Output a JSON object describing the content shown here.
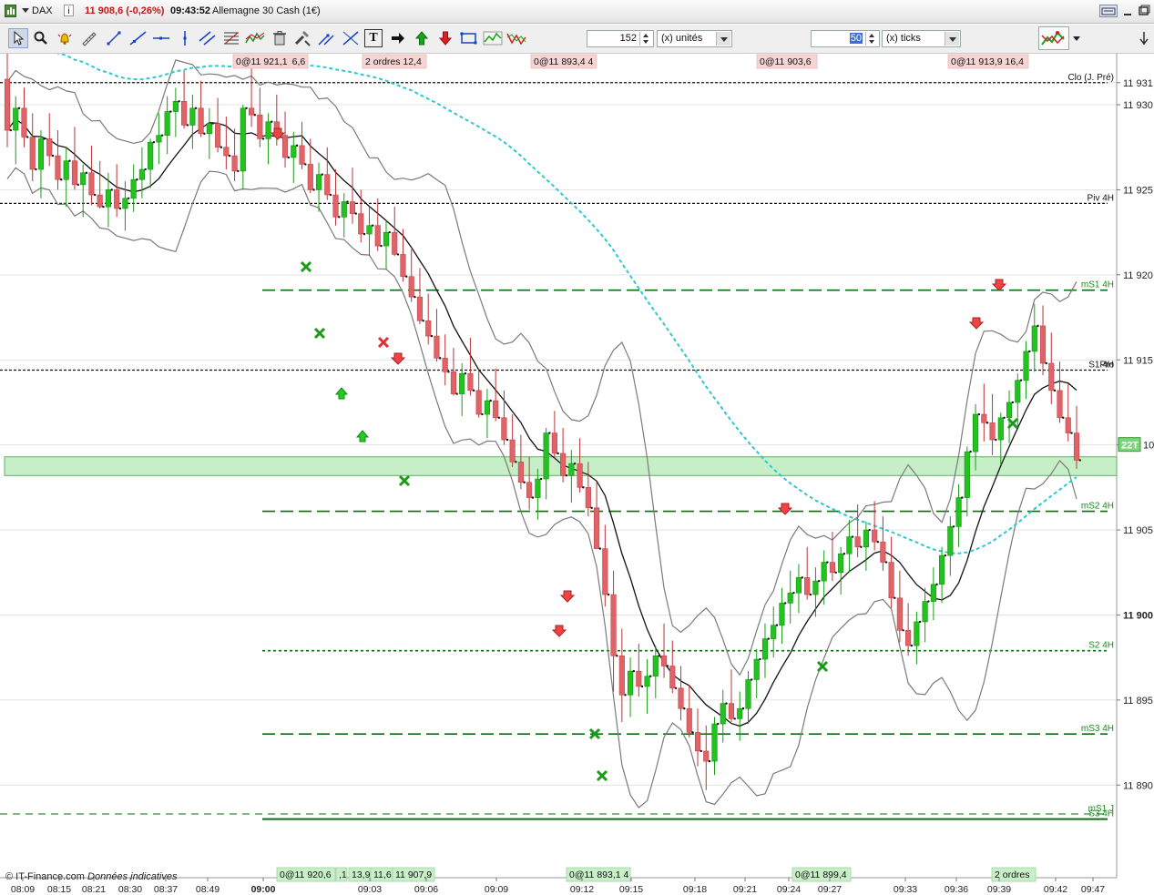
{
  "window": {
    "symbol": "DAX",
    "info": "i",
    "price_change": "11 908,6 (-0,26%)",
    "time": "09:43:52",
    "instrument": "Allemagne 30 Cash (1€)"
  },
  "toolbar": {
    "quantity_value": "152",
    "quantity_unit": "(x) unités",
    "ticks_value": "50",
    "ticks_unit": "(x) ticks"
  },
  "credit": {
    "source": "© IT-Finance.com",
    "note": "Données indicatives"
  },
  "colors": {
    "up": "#22c21f",
    "down": "#e06368",
    "bollinger": "#7a7a7a",
    "mid": "#111111",
    "ma_slow": "#2ec8cf",
    "level_dark": "#0b6e12",
    "zone": "#c7efc7",
    "label_red": "#f7d4d4",
    "label_green": "#c8f0c8"
  },
  "chart_data": {
    "type": "candlestick",
    "instrument": "Allemagne 30 Cash (1€)",
    "ylim": [
      11886,
      11933
    ],
    "ytick_labels": [
      "11 931,",
      "11 930",
      "11 925",
      "11 920",
      "11 915",
      "22T",
      "11 905",
      "11 900",
      "11 895",
      "11 890"
    ],
    "ytick_values": [
      11931.3,
      11930,
      11925,
      11920,
      11915,
      11910,
      11905,
      11900,
      11895,
      11890
    ],
    "xtick_labels": [
      "08:09",
      "08:15",
      "08:21",
      "08:30",
      "08:37",
      "08:49",
      "09:00",
      "09:03",
      "09:06",
      "09:09",
      "09:12",
      "09:15",
      "09:18",
      "09:21",
      "09:24",
      "09:27",
      "09:33",
      "09:36",
      "09:39",
      "09:42",
      "09:47"
    ],
    "current_price": 11908.6,
    "levels": [
      {
        "label": "Clo (J. Pré)",
        "value": 11931.3,
        "style": "dotted-black"
      },
      {
        "label": "Piv 4H",
        "value": 11924.2,
        "style": "dotted-black"
      },
      {
        "label": "mS1 4H",
        "value": 11919.1,
        "style": "dashed-green"
      },
      {
        "label": "S1 4H",
        "value": 11914.4,
        "style": "dotted-black"
      },
      {
        "label": "Pro",
        "value": 11914.4,
        "style": "dotted-black"
      },
      {
        "label": "mS2 4H",
        "value": 11906.1,
        "style": "dashed-green"
      },
      {
        "label": "S2 4H",
        "value": 11897.9,
        "style": "dotted-green"
      },
      {
        "label": "mS3 4H",
        "value": 11893.0,
        "style": "dashed-green"
      },
      {
        "label": "mS1 J",
        "value": 11888.3,
        "style": "dashed-green"
      },
      {
        "label": "S3 4H",
        "value": 11888.0,
        "style": "solid-green"
      }
    ],
    "zone": {
      "from": 11908.2,
      "to": 11909.3
    },
    "order_labels_top": [
      "0@11 921,1  6,6",
      "2 ordres 12,4",
      "0@11 893,4 4",
      "0@11 903,6",
      "0@11 913,9 16,4"
    ],
    "order_labels_bottom": [
      "0@11 920,6",
      ",1",
      "13,9",
      "11,6",
      "11 907,9",
      "0@11 893,1 4",
      "0@11 899,4",
      "2 ordres"
    ],
    "ohlc": [
      [
        11931.5,
        11933,
        11927.5,
        11928.5
      ],
      [
        11928.5,
        11930.5,
        11926.5,
        11929.8
      ],
      [
        11929.8,
        11931,
        11927.5,
        11928.1
      ],
      [
        11928.1,
        11929.5,
        11925.5,
        11926.2
      ],
      [
        11926.2,
        11928.5,
        11924.5,
        11928
      ],
      [
        11928,
        11929.5,
        11926.4,
        11927
      ],
      [
        11927,
        11928.5,
        11925,
        11925.6
      ],
      [
        11925.6,
        11927.5,
        11924,
        11926.7
      ],
      [
        11926.7,
        11928.7,
        11925,
        11925.3
      ],
      [
        11925.3,
        11926.5,
        11923.4,
        11926
      ],
      [
        11926,
        11927.6,
        11924.1,
        11924.7
      ],
      [
        11924.7,
        11926.7,
        11923.9,
        11924
      ],
      [
        11924,
        11926,
        11922.8,
        11925
      ],
      [
        11925,
        11926.5,
        11923.4,
        11923.9
      ],
      [
        11923.9,
        11925.5,
        11922.6,
        11924.5
      ],
      [
        11924.5,
        11926.5,
        11923.7,
        11925.6
      ],
      [
        11925.6,
        11927.5,
        11924.5,
        11926.2
      ],
      [
        11926.2,
        11928,
        11925.1,
        11927.8
      ],
      [
        11927.8,
        11929.5,
        11926.5,
        11928.2
      ],
      [
        11928.2,
        11930.5,
        11927.1,
        11929.6
      ],
      [
        11929.6,
        11931,
        11928.1,
        11930.2
      ],
      [
        11930.2,
        11932,
        11928.6,
        11928.8
      ],
      [
        11928.8,
        11930.6,
        11927.4,
        11929.8
      ],
      [
        11929.8,
        11931.4,
        11928.1,
        11928.3
      ],
      [
        11928.3,
        11929.8,
        11926.8,
        11928.9
      ],
      [
        11928.9,
        11930.4,
        11927.2,
        11927.5
      ],
      [
        11927.5,
        11929.3,
        11926.2,
        11927
      ],
      [
        11927,
        11928.6,
        11925.5,
        11926.1
      ],
      [
        11926.1,
        11930,
        11925,
        11929.8
      ],
      [
        11929.8,
        11932.5,
        11928.7,
        11929.4
      ],
      [
        11929.4,
        11931,
        11927.5,
        11928
      ],
      [
        11928,
        11929.5,
        11926.5,
        11929
      ],
      [
        11929,
        11930.6,
        11927.6,
        11928.2
      ],
      [
        11928.2,
        11929.6,
        11926.3,
        11926.9
      ],
      [
        11926.9,
        11928.4,
        11925.4,
        11927.6
      ],
      [
        11927.6,
        11929,
        11926.2,
        11926.5
      ],
      [
        11926.5,
        11928,
        11924.8,
        11925
      ],
      [
        11925,
        11926.6,
        11923.7,
        11925.9
      ],
      [
        11925.9,
        11927.5,
        11924.4,
        11924.7
      ],
      [
        11924.7,
        11926.2,
        11922.9,
        11923.4
      ],
      [
        11923.4,
        11924.8,
        11922.2,
        11924.3
      ],
      [
        11924.3,
        11926.3,
        11923,
        11923.6
      ],
      [
        11923.6,
        11925,
        11921.9,
        11922.4
      ],
      [
        11922.4,
        11924,
        11921.1,
        11922.9
      ],
      [
        11922.9,
        11924.5,
        11921.4,
        11921.7
      ],
      [
        11921.7,
        11923.2,
        11920.3,
        11922.5
      ],
      [
        11922.5,
        11924,
        11921.1,
        11921.2
      ],
      [
        11921.2,
        11922.7,
        11919.6,
        11919.9
      ],
      [
        11919.9,
        11921.5,
        11918.4,
        11918.7
      ],
      [
        11918.7,
        11920.4,
        11917.1,
        11917.3
      ],
      [
        11917.3,
        11918.9,
        11915.9,
        11916.4
      ],
      [
        11916.4,
        11918,
        11914.9,
        11915.1
      ],
      [
        11915.1,
        11916.5,
        11913.5,
        11914.3
      ],
      [
        11914.3,
        11915.7,
        11912.9,
        11913
      ],
      [
        11913,
        11914.8,
        11911.7,
        11914.2
      ],
      [
        11914.2,
        11916.3,
        11912.9,
        11913.2
      ],
      [
        11913.2,
        11914.5,
        11911.6,
        11911.8
      ],
      [
        11911.8,
        11913.3,
        11910.4,
        11912.6
      ],
      [
        11912.6,
        11914.5,
        11911.4,
        11911.6
      ],
      [
        11911.6,
        11913.2,
        11910,
        11910.3
      ],
      [
        11910.3,
        11911.8,
        11908.7,
        11909
      ],
      [
        11909,
        11910.6,
        11907.4,
        11907.8
      ],
      [
        11907.8,
        11909.3,
        11906.2,
        11906.9
      ],
      [
        11906.9,
        11908.6,
        11905.6,
        11908
      ],
      [
        11908,
        11911,
        11906.8,
        11910.7
      ],
      [
        11910.7,
        11912,
        11909.2,
        11909.5
      ],
      [
        11909.5,
        11911,
        11907.8,
        11908.2
      ],
      [
        11908.2,
        11909.7,
        11906.6,
        11908.9
      ],
      [
        11908.9,
        11910.4,
        11907.2,
        11907.5
      ],
      [
        11907.5,
        11909,
        11905.8,
        11906.3
      ],
      [
        11906.3,
        11907.8,
        11904.6,
        11903.9
      ],
      [
        11903.9,
        11905.3,
        11900.5,
        11901.2
      ],
      [
        11901.2,
        11902.6,
        11895.5,
        11897.6
      ],
      [
        11897.6,
        11899.2,
        11893.7,
        11895.3
      ],
      [
        11895.3,
        11897.5,
        11894,
        11896.7
      ],
      [
        11896.7,
        11898.3,
        11895.2,
        11895.8
      ],
      [
        11895.8,
        11897.4,
        11894.2,
        11896.4
      ],
      [
        11896.4,
        11898.2,
        11895.1,
        11897.6
      ],
      [
        11897.6,
        11899.5,
        11896.3,
        11897
      ],
      [
        11897,
        11898.5,
        11895.4,
        11895.7
      ],
      [
        11895.7,
        11897,
        11893.8,
        11894.5
      ],
      [
        11894.5,
        11895.9,
        11892.8,
        11893.1
      ],
      [
        11893.1,
        11894.5,
        11891.1,
        11892
      ],
      [
        11892,
        11893.5,
        11889.7,
        11891.4
      ],
      [
        11891.4,
        11894,
        11890.6,
        11893.6
      ],
      [
        11893.6,
        11895.6,
        11892.5,
        11894.8
      ],
      [
        11894.8,
        11896.8,
        11893.7,
        11893.9
      ],
      [
        11893.9,
        11895.5,
        11892.6,
        11894.5
      ],
      [
        11894.5,
        11896.7,
        11893.6,
        11896.2
      ],
      [
        11896.2,
        11898,
        11895.1,
        11897.4
      ],
      [
        11897.4,
        11899.5,
        11896.3,
        11898.6
      ],
      [
        11898.6,
        11900.5,
        11897.5,
        11899.4
      ],
      [
        11899.4,
        11901.6,
        11898.3,
        11900.7
      ],
      [
        11900.7,
        11902.6,
        11899.5,
        11901.3
      ],
      [
        11901.3,
        11903,
        11900.1,
        11902.2
      ],
      [
        11902.2,
        11904,
        11900.9,
        11901.2
      ],
      [
        11901.2,
        11902.8,
        11899.9,
        11902
      ],
      [
        11902,
        11903.8,
        11900.6,
        11903.1
      ],
      [
        11903.1,
        11904.9,
        11902,
        11902.5
      ],
      [
        11902.5,
        11904,
        11901.2,
        11903.6
      ],
      [
        11903.6,
        11905.6,
        11902.5,
        11904.6
      ],
      [
        11904.6,
        11906.5,
        11903.4,
        11904
      ],
      [
        11904,
        11905.5,
        11902.6,
        11905
      ],
      [
        11905,
        11906.7,
        11903.8,
        11904.3
      ],
      [
        11904.3,
        11905.8,
        11902.6,
        11903.1
      ],
      [
        11903.1,
        11904.6,
        11900.4,
        11901
      ],
      [
        11901,
        11902.6,
        11898.4,
        11899.1
      ],
      [
        11899.1,
        11900.7,
        11897.6,
        11898.2
      ],
      [
        11898.2,
        11900.2,
        11897.1,
        11899.6
      ],
      [
        11899.6,
        11901.6,
        11898.4,
        11900.8
      ],
      [
        11900.8,
        11902.8,
        11899.7,
        11901.8
      ],
      [
        11901.8,
        11904,
        11900.7,
        11903.5
      ],
      [
        11903.5,
        11905.8,
        11902.3,
        11905.2
      ],
      [
        11905.2,
        11907.7,
        11904,
        11906.9
      ],
      [
        11906.9,
        11909.9,
        11905.8,
        11909.6
      ],
      [
        11909.6,
        11912.4,
        11908.5,
        11911.8
      ],
      [
        11911.8,
        11913.6,
        11910.2,
        11911.3
      ],
      [
        11911.3,
        11913,
        11909.4,
        11910.3
      ],
      [
        11910.3,
        11911.9,
        11908.8,
        11911.6
      ],
      [
        11911.6,
        11913.2,
        11910.1,
        11912.5
      ],
      [
        11912.5,
        11914.2,
        11911.1,
        11913.8
      ],
      [
        11913.8,
        11916.1,
        11912.7,
        11915.5
      ],
      [
        11915.5,
        11918.3,
        11914.3,
        11917
      ],
      [
        11917,
        11918.2,
        11914.1,
        11914.8
      ],
      [
        11914.8,
        11916.6,
        11912.4,
        11913.2
      ],
      [
        11913.2,
        11914.9,
        11911.3,
        11911.6
      ],
      [
        11911.6,
        11913.6,
        11910.2,
        11910.7
      ],
      [
        11910.7,
        11912.3,
        11908.6,
        11909.1
      ]
    ]
  }
}
